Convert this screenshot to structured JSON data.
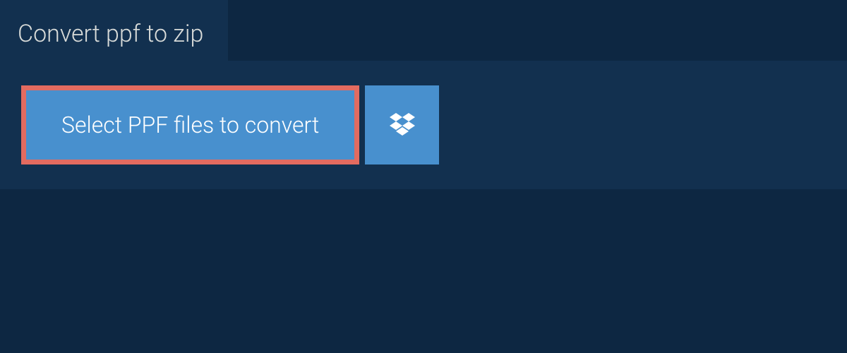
{
  "tab": {
    "title": "Convert ppf to zip"
  },
  "upload": {
    "select_button_label": "Select PPF files to convert"
  },
  "colors": {
    "bg_dark": "#0d2742",
    "bg_panel": "#12304f",
    "button_blue": "#4890ce",
    "highlight_red": "#e36b60",
    "text_light": "#d8dbd9",
    "text_white": "#ffffff"
  }
}
